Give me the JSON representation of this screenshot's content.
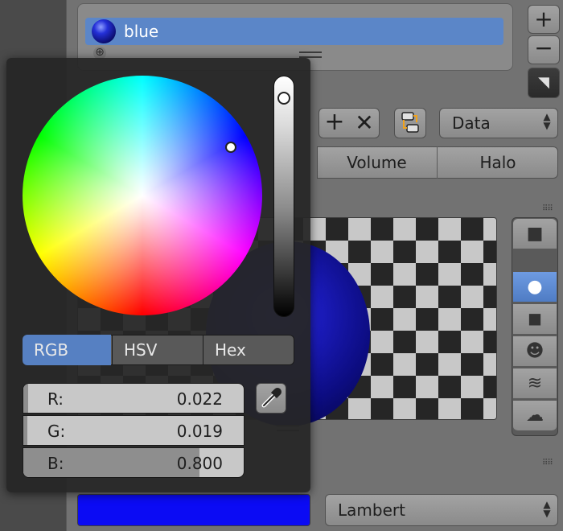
{
  "material_slots": {
    "items": [
      {
        "label": "blue",
        "active": true
      }
    ],
    "add_icon": "plus-icon",
    "remove_icon": "minus-icon",
    "menu_icon": "down-arrow-menu-icon"
  },
  "datablock": {
    "new_icon": "plus-icon",
    "unlink_icon": "x-icon",
    "browse_icon": "node-link-icon",
    "link_dropdown": "Data"
  },
  "material_type_tabs": [
    "Volume",
    "Halo"
  ],
  "preview_types": [
    "flat-icon",
    "sphere-icon",
    "cube-icon",
    "monkey-icon",
    "hair-icon",
    "sky-icon"
  ],
  "preview_active": "sphere-icon",
  "diffuse": {
    "color": "#0b0bf4",
    "shader": "Lambert"
  },
  "color_picker": {
    "modes": [
      "RGB",
      "HSV",
      "Hex"
    ],
    "active_mode": "RGB",
    "channels": [
      {
        "label": "R:",
        "value": "0.022",
        "fill": 0.022
      },
      {
        "label": "G:",
        "value": "0.019",
        "fill": 0.019
      },
      {
        "label": "B:",
        "value": "0.800",
        "fill": 0.8
      }
    ],
    "eyedropper_icon": "eyedropper-icon"
  }
}
